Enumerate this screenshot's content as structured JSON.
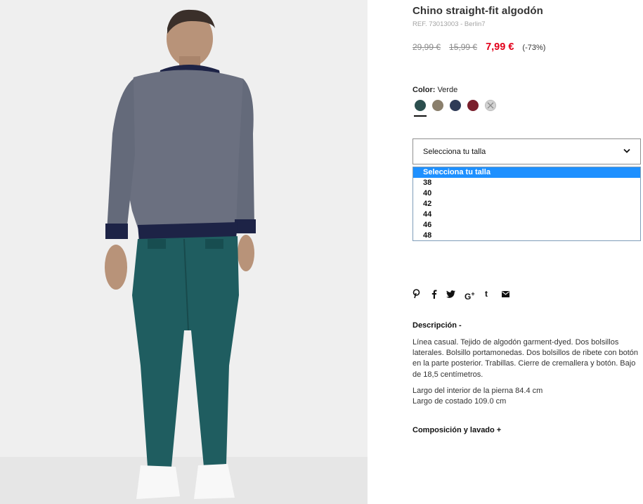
{
  "product": {
    "title": "Chino straight-fit algodón",
    "ref": "REF. 73013003 - Berlin7",
    "price_original": "29,99 €",
    "price_previous": "15,99 €",
    "price_current": "7,99 €",
    "discount": "(-73%)"
  },
  "color": {
    "label": "Color:",
    "selected": "Verde",
    "swatches": [
      {
        "name": "green",
        "hex": "#2c4f4e",
        "active": true
      },
      {
        "name": "khaki",
        "hex": "#8a7f6c",
        "active": false
      },
      {
        "name": "navy",
        "hex": "#2f3b57",
        "active": false
      },
      {
        "name": "burgundy",
        "hex": "#7a1f2c",
        "active": false
      },
      {
        "name": "unavailable",
        "hex": "#d3d3d3",
        "active": false
      }
    ]
  },
  "size": {
    "select_label": "Selecciona tu talla",
    "options": [
      "Selecciona tu talla",
      "38",
      "40",
      "42",
      "44",
      "46",
      "48"
    ]
  },
  "share": [
    "pinterest-icon",
    "facebook-icon",
    "twitter-icon",
    "google-plus-icon",
    "tumblr-icon",
    "email-icon"
  ],
  "description": {
    "title": "Descripción -",
    "text": "Línea casual. Tejido de algodón garment-dyed. Dos bolsillos laterales. Bolsillo portamonedas. Dos bolsillos de ribete con botón en la parte posterior. Trabillas. Cierre de cremallera y botón. Bajo de 18,5 centímetros.",
    "measure1": "Largo del interior de la pierna 84.4 cm",
    "measure2": "Largo de costado 109.0 cm"
  },
  "composition": {
    "title": "Composición y lavado +"
  },
  "colors": {
    "sale": "#e2001a",
    "dropdown_highlight": "#1e90ff",
    "pants": "#1f5d60",
    "sweater": "#6b7080"
  }
}
